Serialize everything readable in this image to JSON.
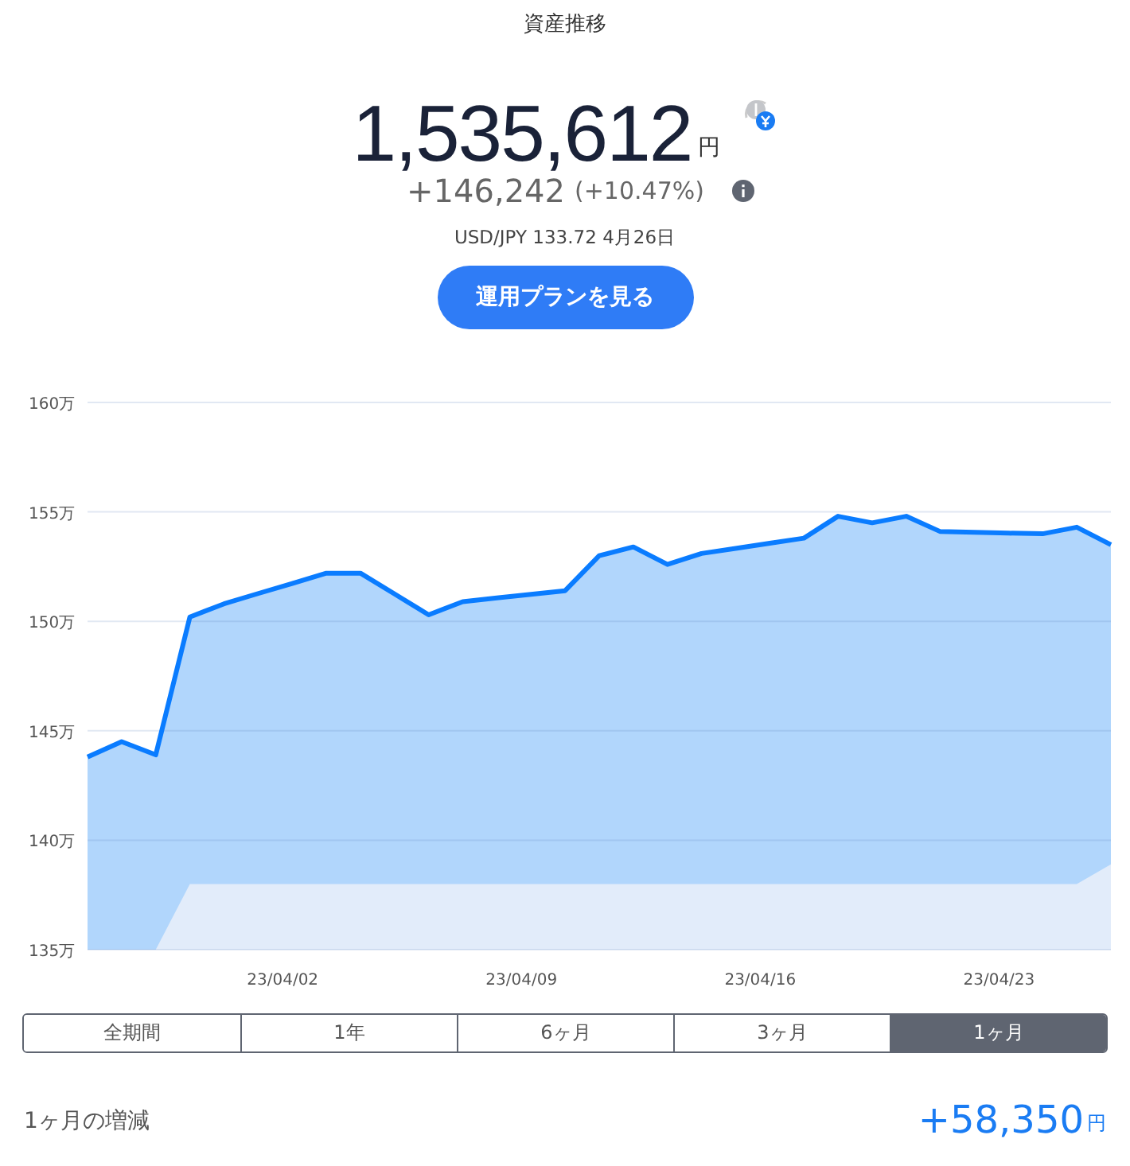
{
  "title": "資産推移",
  "total": {
    "amount": "1,535,612",
    "unit": "円"
  },
  "change": {
    "amount": "+146,242",
    "percent": "(+10.47%)"
  },
  "rate": "USD/JPY 133.72 4月26日",
  "plan_button": "運用プランを見る",
  "chart_data": {
    "type": "area",
    "ylim": [
      135,
      160
    ],
    "grid": true,
    "categories": [
      null,
      null,
      null,
      null,
      null,
      null,
      "23/04/02",
      null,
      null,
      null,
      null,
      null,
      null,
      "23/04/09",
      null,
      null,
      null,
      null,
      null,
      null,
      "23/04/16",
      null,
      null,
      null,
      null,
      null,
      null,
      "23/04/23",
      null,
      null,
      null
    ],
    "yticks": [
      {
        "value": 135,
        "label": "135万"
      },
      {
        "value": 140,
        "label": "140万"
      },
      {
        "value": 145,
        "label": "145万"
      },
      {
        "value": 150,
        "label": "150万"
      },
      {
        "value": 155,
        "label": "155万"
      },
      {
        "value": 160,
        "label": "160万"
      }
    ],
    "series": [
      {
        "color": "#0a7cff",
        "values": [
          143.8,
          144.5,
          143.9,
          150.2,
          150.8,
          151.27,
          151.73,
          152.2,
          152.2,
          151.25,
          150.3,
          150.9,
          151.07,
          151.23,
          151.4,
          153.0,
          153.4,
          152.6,
          153.1,
          153.33,
          153.57,
          153.8,
          154.8,
          154.5,
          154.8,
          154.1,
          154.07,
          154.03,
          154.0,
          154.3,
          153.5
        ]
      },
      {
        "color": "#e2ecfa",
        "values": [
          135,
          135,
          135,
          138,
          138,
          138,
          138,
          138,
          138,
          138,
          138,
          138,
          138,
          138,
          138,
          138,
          138,
          138,
          138,
          138,
          138,
          138,
          138,
          138,
          138,
          138,
          138,
          138,
          138,
          138,
          138.9
        ]
      }
    ]
  },
  "periods": [
    {
      "label": "全期間",
      "selected": false
    },
    {
      "label": "1年",
      "selected": false
    },
    {
      "label": "6ヶ月",
      "selected": false
    },
    {
      "label": "3ヶ月",
      "selected": false
    },
    {
      "label": "1ヶ月",
      "selected": true
    }
  ],
  "summary": {
    "label": "1ヶ月の増減",
    "amount": "+58,350",
    "unit": "円"
  }
}
